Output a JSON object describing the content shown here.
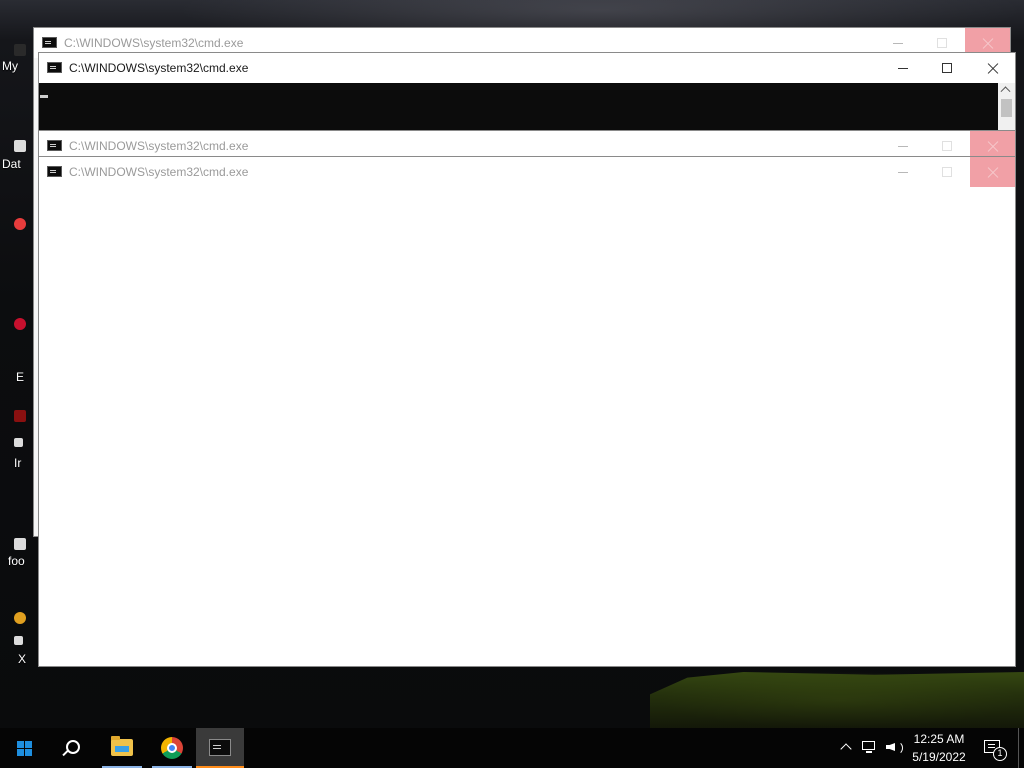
{
  "desktop": {
    "icons": [
      {
        "label": "My"
      },
      {
        "label": "Dat"
      },
      {
        "label": ""
      },
      {
        "label": ""
      },
      {
        "label": "E"
      },
      {
        "label": "Ir"
      },
      {
        "label": "foo"
      },
      {
        "label": "X"
      }
    ]
  },
  "windows": [
    {
      "title": "C:\\WINDOWS\\system32\\cmd.exe",
      "state": "inactive"
    },
    {
      "title": "C:\\WINDOWS\\system32\\cmd.exe",
      "state": "active"
    },
    {
      "title": "C:\\WINDOWS\\system32\\cmd.exe",
      "state": "inactive"
    },
    {
      "title": "C:\\WINDOWS\\system32\\cmd.exe",
      "state": "inactive"
    }
  ],
  "taskbar": {
    "pinned": [
      {
        "icon": "windows-start-icon"
      },
      {
        "icon": "search-icon"
      },
      {
        "icon": "file-explorer-icon"
      },
      {
        "icon": "chrome-icon"
      },
      {
        "icon": "command-prompt-icon"
      }
    ],
    "clock": {
      "time": "12:25 AM",
      "date": "5/19/2022"
    },
    "notifications": {
      "count": "1"
    }
  },
  "colors": {
    "start_blue": "#1e8fe0",
    "close_inactive": "#f1a0a6",
    "active_task_underline": "#ff8c1a",
    "console_bg": "#0c0c0c"
  }
}
